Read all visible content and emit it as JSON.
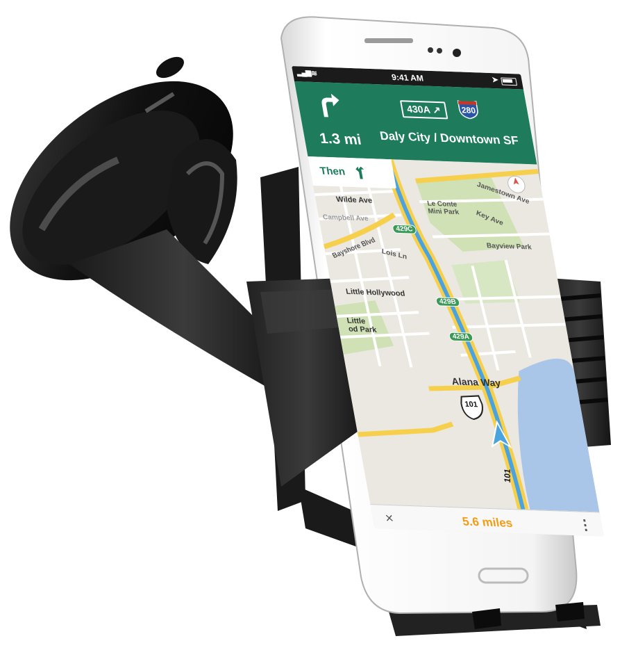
{
  "status_bar": {
    "time": "9:41 AM"
  },
  "navigation": {
    "distance": "1.3 mi",
    "exit_sign": "430A ↗",
    "route_shield": "280",
    "destination": "Daly City / Downtown SF",
    "then_label": "Then"
  },
  "map": {
    "labels": {
      "wilde_ave": "Wilde Ave",
      "campbell_ave": "Campbell Ave",
      "le_conte": "Le Conte\nMini Park",
      "jamestown_ave": "Jamestown Ave",
      "key_ave": "Key Ave",
      "bayview_park": "Bayview Park",
      "bayshore_blvd": "Bayshore Blvd",
      "lois_ln": "Lois Ln",
      "little_hollywood": "Little Hollywood",
      "little_park": "Little\nod Park",
      "alana_way": "Alana Way",
      "route_101_shield": "101",
      "route_101_road": "101"
    },
    "exits": [
      "429C",
      "429B",
      "429A"
    ]
  },
  "bottom_bar": {
    "remaining": "5.6 miles",
    "close_glyph": "×",
    "more_glyph": "⋮"
  },
  "colors": {
    "nav_green": "#1e7c5c",
    "route_blue": "#4aa3df",
    "highway_yellow": "#f6d04d",
    "water": "#a9c6e8",
    "park_green": "#c9dfb0",
    "accent_orange": "#f39c12"
  },
  "icons": [
    "turn-right-arrow-icon",
    "bear-right-arrow-icon",
    "signal-icon",
    "wifi-icon",
    "battery-icon",
    "location-arrow-icon",
    "compass-icon",
    "position-arrow-icon",
    "close-icon",
    "more-icon"
  ]
}
